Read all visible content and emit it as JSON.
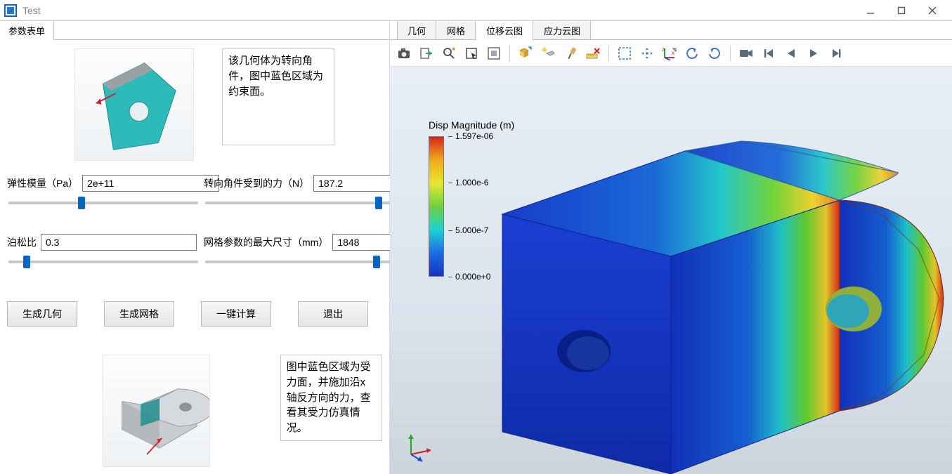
{
  "window": {
    "title": "Test"
  },
  "left_tabs": {
    "params": "参数表单"
  },
  "right_tabs": {
    "geometry": "几何",
    "mesh": "网格",
    "disp_cloud": "位移云图",
    "stress_cloud": "应力云图"
  },
  "description1": "该几何体为转向角件，图中蓝色区域为约束面。",
  "description2": "图中蓝色区域为受力面，并施加沿x轴反方向的力，查看其受力仿真情况。",
  "fields": {
    "elastic_modulus": {
      "label": "弹性模量（Pa）",
      "value": "2e+11"
    },
    "force": {
      "label": "转向角件受到的力（N）",
      "value": "187.2"
    },
    "poisson": {
      "label": "泊松比",
      "value": "0.3"
    },
    "mesh_size": {
      "label": "网格参数的最大尺寸（mm）",
      "value": "1848"
    }
  },
  "buttons": {
    "gen_geometry": "生成几何",
    "gen_mesh": "生成网格",
    "compute": "一键计算",
    "exit": "退出"
  },
  "legend": {
    "title": "Disp Magnitude (m)",
    "ticks": [
      {
        "pos": 0,
        "label": "1.597e-06"
      },
      {
        "pos": 33,
        "label": "1.000e-6"
      },
      {
        "pos": 67,
        "label": "5.000e-7"
      },
      {
        "pos": 100,
        "label": "0.000e+0"
      }
    ]
  },
  "toolbar_icons": [
    "camera-icon",
    "export-icon",
    "zoom-fit-icon",
    "select-rect-icon",
    "select-box-icon",
    "sep",
    "multi-viewport-icon",
    "light-icon",
    "paint-icon",
    "ruler-delete-icon",
    "sep",
    "marquee-icon",
    "pan-icon",
    "axes-icon",
    "rotate-ccw-icon",
    "rotate-cw-icon",
    "sep",
    "record-icon",
    "first-frame-icon",
    "prev-frame-icon",
    "play-icon",
    "next-frame-icon"
  ]
}
